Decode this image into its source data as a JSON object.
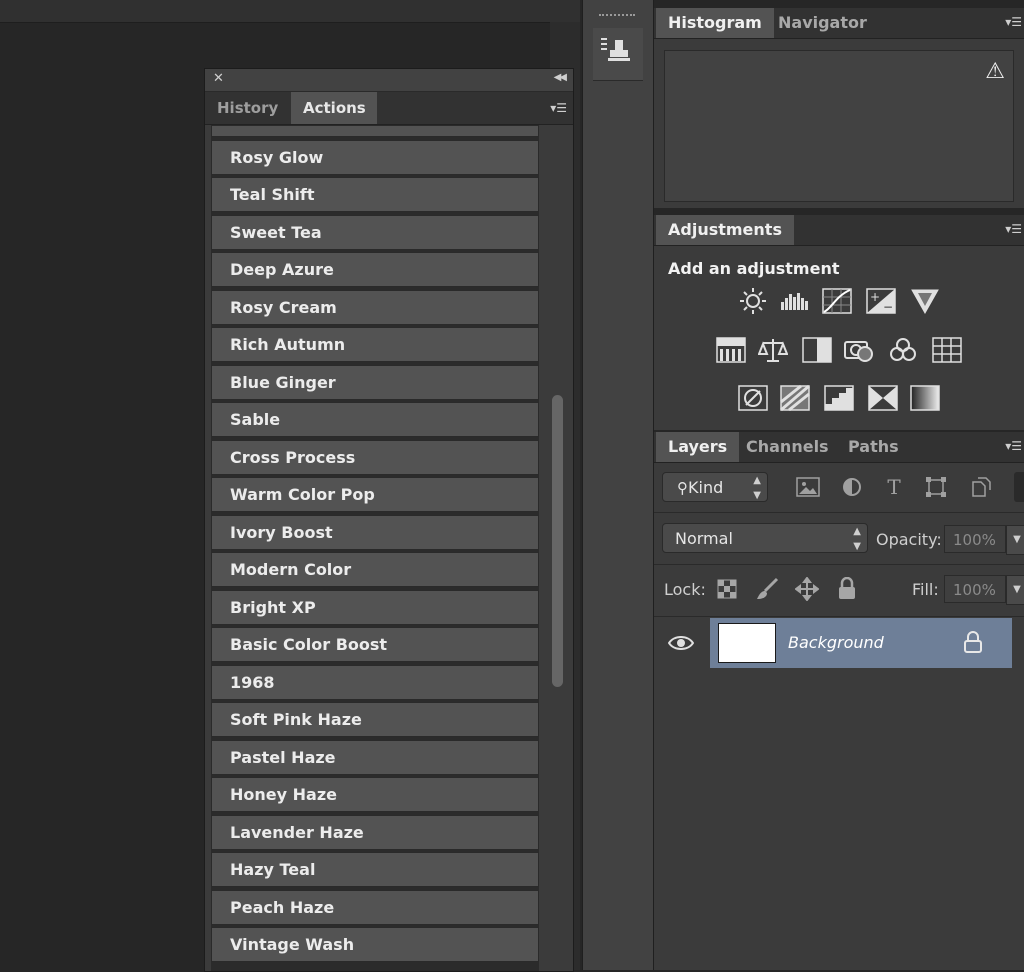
{
  "actions_panel": {
    "tabs": [
      "History",
      "Actions"
    ],
    "active_tab": "Actions",
    "items": [
      "Rosy Glow",
      "Teal Shift",
      "Sweet Tea",
      "Deep Azure",
      "Rosy Cream",
      "Rich Autumn",
      "Blue Ginger",
      "Sable",
      "Cross Process",
      "Warm Color Pop",
      "Ivory Boost",
      "Modern Color",
      "Bright XP",
      "Basic Color Boost",
      "1968",
      "Soft Pink Haze",
      "Pastel Haze",
      "Honey Haze",
      "Lavender Haze",
      "Hazy Teal",
      "Peach Haze",
      "Vintage Wash"
    ]
  },
  "histogram_panel": {
    "tabs": [
      "Histogram",
      "Navigator"
    ],
    "active_tab": "Histogram"
  },
  "adjustments_panel": {
    "tab": "Adjustments",
    "heading": "Add an adjustment",
    "icons": [
      "brightness-contrast",
      "levels",
      "curves",
      "exposure",
      "vibrance",
      "hue-saturation",
      "color-balance",
      "black-white",
      "photo-filter",
      "channel-mixer",
      "color-lookup",
      "invert",
      "posterize",
      "threshold",
      "selective-color",
      "gradient-map"
    ]
  },
  "layers_panel": {
    "tabs": [
      "Layers",
      "Channels",
      "Paths"
    ],
    "active_tab": "Layers",
    "filter_label": "Kind",
    "blend_mode": "Normal",
    "opacity_label": "Opacity:",
    "opacity_value": "100%",
    "lock_label": "Lock:",
    "fill_label": "Fill:",
    "fill_value": "100%",
    "layers": [
      {
        "name": "Background",
        "visible": true,
        "locked": true
      }
    ]
  },
  "colors": {
    "selection": "#6e7f98",
    "panel": "#3b3b3b",
    "item": "#535353"
  }
}
